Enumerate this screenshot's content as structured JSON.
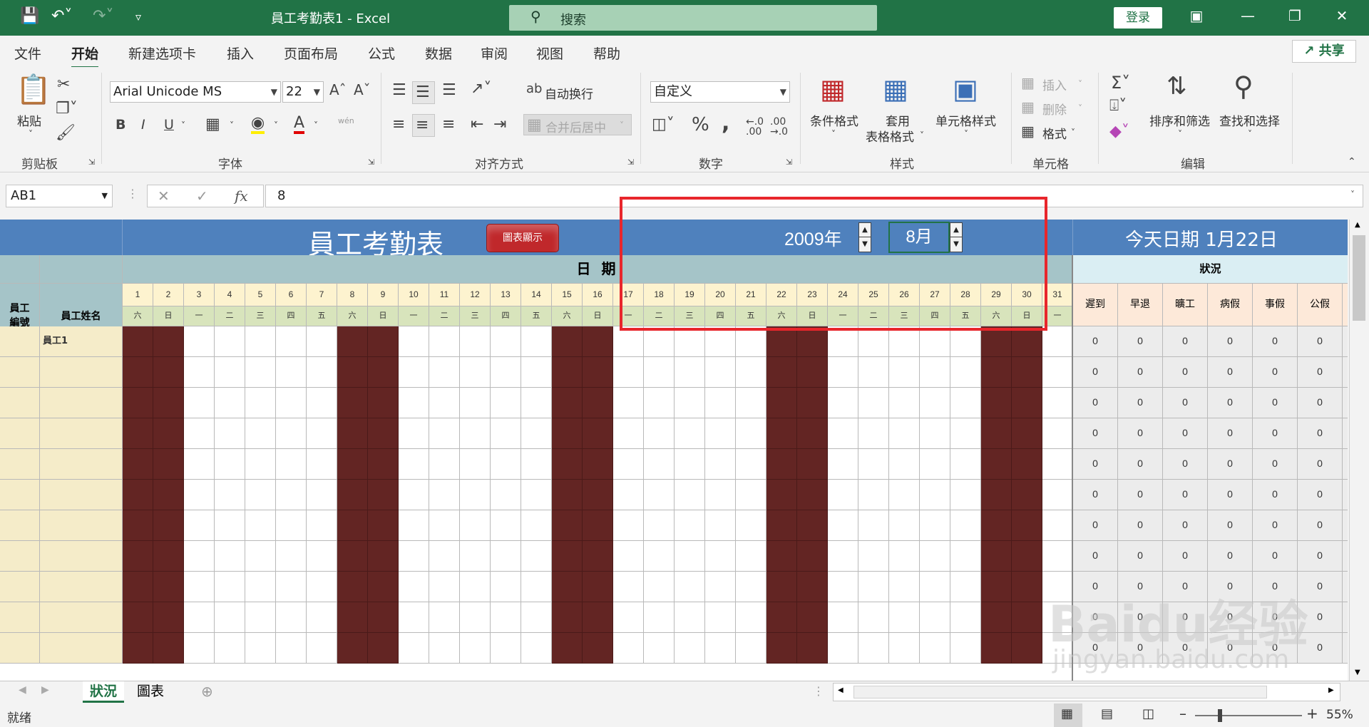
{
  "window": {
    "title": "員工考勤表1  -  Excel",
    "search_placeholder": "搜索",
    "login_label": "登录"
  },
  "tabs": [
    "文件",
    "开始",
    "新建选项卡",
    "插入",
    "页面布局",
    "公式",
    "数据",
    "审阅",
    "视图",
    "帮助"
  ],
  "share_label": "共享",
  "ribbon": {
    "clipboard": {
      "paste": "粘贴",
      "label": "剪贴板"
    },
    "font": {
      "name": "Arial Unicode MS",
      "size": "22",
      "label": "字体",
      "bold": "B",
      "italic": "I",
      "underline": "U",
      "phonetic": "wén"
    },
    "alignment": {
      "wrap": "自动换行",
      "merge": "合并后居中",
      "label": "对齐方式"
    },
    "number": {
      "format": "自定义",
      "label": "数字"
    },
    "styles": {
      "conditional": "条件格式",
      "table_line1": "套用",
      "table_line2": "表格格式",
      "cell_styles": "单元格样式",
      "label": "样式"
    },
    "cells": {
      "insert": "插入",
      "delete": "删除",
      "format": "格式",
      "label": "单元格"
    },
    "editing": {
      "sort": "排序和筛选",
      "find": "查找和选择",
      "label": "编辑"
    }
  },
  "formula_bar": {
    "name_box": "AB1",
    "value": "8",
    "fx": "fx"
  },
  "sheet": {
    "title": "員工考勤表",
    "chart_button": "圖表顯示",
    "year": "2009年",
    "month": "8月",
    "today": "今天日期  1月22日",
    "date_header": "日  期",
    "status_header": "狀況",
    "emp_id_header_line1": "員工",
    "emp_id_header_line2": "編號",
    "emp_name_header": "員工姓名",
    "days": [
      "1",
      "2",
      "3",
      "4",
      "5",
      "6",
      "7",
      "8",
      "9",
      "10",
      "11",
      "12",
      "13",
      "14",
      "15",
      "16",
      "17",
      "18",
      "19",
      "20",
      "21",
      "22",
      "23",
      "24",
      "25",
      "26",
      "27",
      "28",
      "29",
      "30",
      "31"
    ],
    "weekdays": [
      "六",
      "日",
      "一",
      "二",
      "三",
      "四",
      "五",
      "六",
      "日",
      "一",
      "二",
      "三",
      "四",
      "五",
      "六",
      "日",
      "一",
      "二",
      "三",
      "四",
      "五",
      "六",
      "日",
      "一",
      "二",
      "三",
      "四",
      "五",
      "六",
      "日",
      "一"
    ],
    "status_cols": [
      "遲到",
      "早退",
      "曠工",
      "病假",
      "事假",
      "公假"
    ],
    "rows": [
      {
        "name": "員工1",
        "values": [
          "0",
          "0",
          "0",
          "0",
          "0",
          "0"
        ]
      },
      {
        "name": "",
        "values": [
          "0",
          "0",
          "0",
          "0",
          "0",
          "0"
        ]
      },
      {
        "name": "",
        "values": [
          "0",
          "0",
          "0",
          "0",
          "0",
          "0"
        ]
      },
      {
        "name": "",
        "values": [
          "0",
          "0",
          "0",
          "0",
          "0",
          "0"
        ]
      },
      {
        "name": "",
        "values": [
          "0",
          "0",
          "0",
          "0",
          "0",
          "0"
        ]
      },
      {
        "name": "",
        "values": [
          "0",
          "0",
          "0",
          "0",
          "0",
          "0"
        ]
      },
      {
        "name": "",
        "values": [
          "0",
          "0",
          "0",
          "0",
          "0",
          "0"
        ]
      },
      {
        "name": "",
        "values": [
          "0",
          "0",
          "0",
          "0",
          "0",
          "0"
        ]
      },
      {
        "name": "",
        "values": [
          "0",
          "0",
          "0",
          "0",
          "0",
          "0"
        ]
      },
      {
        "name": "",
        "values": [
          "0",
          "0",
          "0",
          "0",
          "0",
          "0"
        ]
      },
      {
        "name": "",
        "values": [
          "0",
          "0",
          "0",
          "0",
          "0",
          "0"
        ]
      }
    ]
  },
  "sheet_tabs": [
    "狀況",
    "圖表"
  ],
  "status_bar": {
    "ready": "就绪",
    "zoom": "55%"
  },
  "watermark": {
    "logo": "Baidu经验",
    "url": "jingyan.baidu.com"
  },
  "colors": {
    "excel_green": "#217346",
    "header_blue": "#4f81bd",
    "weekend": "#632523",
    "highlight_red": "#e8262c"
  }
}
